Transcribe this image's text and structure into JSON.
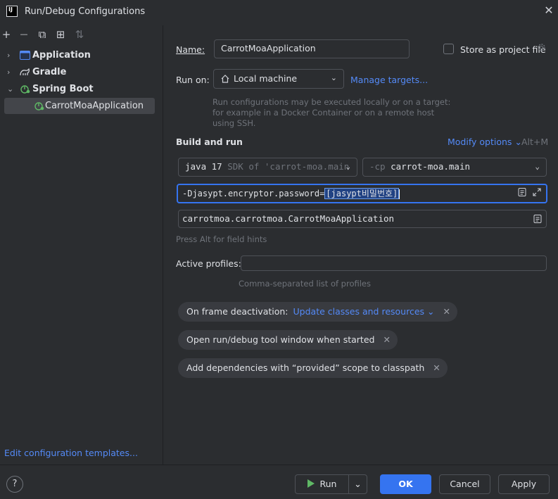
{
  "window": {
    "title": "Run/Debug Configurations",
    "logo_text": "IJ",
    "close_glyph": "✕"
  },
  "toolbar": {
    "add_glyph": "+",
    "remove_glyph": "—",
    "copy_glyph": "⧉",
    "folder_glyph": "⊞",
    "sort_glyph": "⇅"
  },
  "tree": {
    "items": [
      {
        "label": "Application",
        "chevron": "›",
        "icon": "application-icon"
      },
      {
        "label": "Gradle",
        "chevron": "›",
        "icon": "gradle-icon"
      },
      {
        "label": "Spring Boot",
        "chevron": "⌄",
        "icon": "spring-boot-icon"
      },
      {
        "label": "CarrotMoaApplication",
        "icon": "spring-boot-icon"
      }
    ],
    "edit_templates": "Edit configuration templates..."
  },
  "form": {
    "name_label": "Name:",
    "name_value": "CarrotMoaApplication",
    "store_label": "Store as project file",
    "runon_label": "Run on:",
    "runon_value": "Local machine",
    "manage_targets": "Manage targets...",
    "runon_hint": "Run configurations may be executed locally or on a target: for example in a Docker Container or on a remote host using SSH.",
    "build_title": "Build and run",
    "modify_options": "Modify options",
    "modify_shortcut": "Alt+M",
    "jdk_main": "java 17",
    "jdk_dim": "SDK of 'carrot-moa.main",
    "cp_dim": "-cp",
    "cp_main": "carrot-moa.main",
    "vm_prefix": "-Djasypt.encryptor.password=",
    "vm_selected": "[jasypt비밀번호]",
    "main_class": "carrotmoa.carrotmoa.CarrotMoaApplication",
    "alt_hint": "Press Alt for field hints",
    "profiles_label": "Active profiles:",
    "profiles_value": "",
    "profiles_hint": "Comma-separated list of profiles"
  },
  "chips": [
    {
      "label": "On frame deactivation:",
      "link": "Update classes and resources"
    },
    {
      "label": "Open run/debug tool window when started"
    },
    {
      "label": "Add dependencies with “provided” scope to classpath"
    }
  ],
  "buttons": {
    "help": "?",
    "run": "Run",
    "ok": "OK",
    "cancel": "Cancel",
    "apply": "Apply"
  },
  "colors": {
    "background": "#2b2d30",
    "accent": "#3574f0",
    "link": "#548af7",
    "spring_green": "#5fb865"
  }
}
